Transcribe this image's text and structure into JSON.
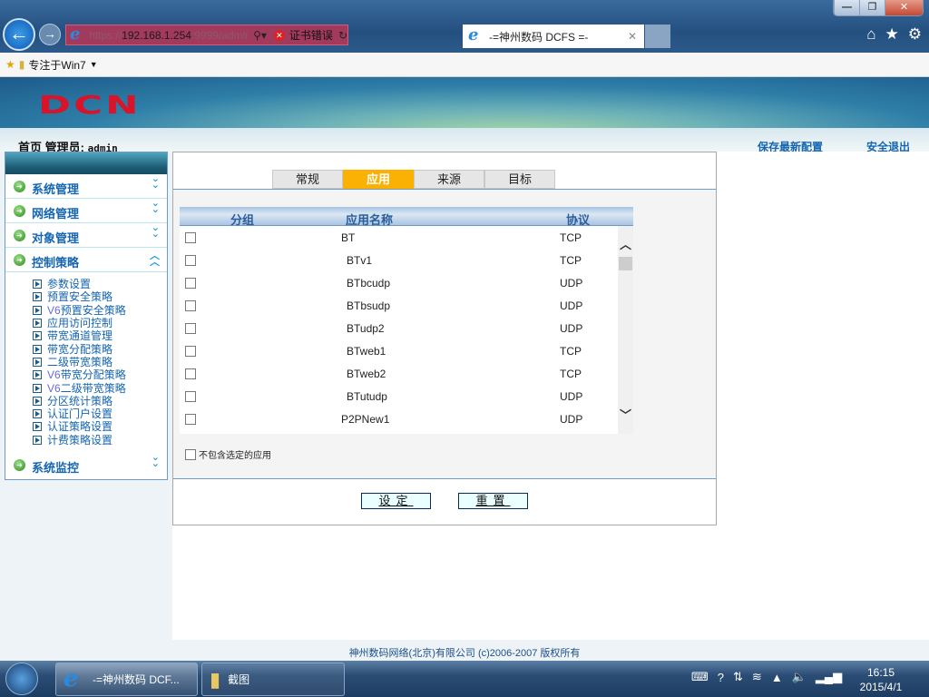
{
  "browser": {
    "url_host": "192.168.1.254",
    "url_prefix": "https://",
    "url_suffix": ":9999/admin/show/syster",
    "cert_error": "证书错误",
    "tab_title": "-=神州数码 DCFS =-",
    "favorites_folder": "专注于Win7"
  },
  "header": {
    "logo": "DCN",
    "home": "首页",
    "admin_label": "管理员:",
    "admin_name": "admin",
    "save_config": "保存最新配置",
    "logout": "安全退出"
  },
  "sidebar": {
    "menus": [
      {
        "label": "系统管理"
      },
      {
        "label": "网络管理"
      },
      {
        "label": "对象管理"
      },
      {
        "label": "控制策略"
      }
    ],
    "subitems": [
      {
        "prefix": "",
        "label": "参数设置"
      },
      {
        "prefix": "",
        "label": "预置安全策略"
      },
      {
        "prefix": "V6",
        "label": "预置安全策略"
      },
      {
        "prefix": "",
        "label": "应用访问控制"
      },
      {
        "prefix": "",
        "label": "带宽通道管理"
      },
      {
        "prefix": "",
        "label": "带宽分配策略"
      },
      {
        "prefix": "",
        "label": "二级带宽策略"
      },
      {
        "prefix": "V6",
        "label": "带宽分配策略"
      },
      {
        "prefix": "V6",
        "label": "二级带宽策略"
      },
      {
        "prefix": "",
        "label": "分区统计策略"
      },
      {
        "prefix": "",
        "label": "认证门户设置"
      },
      {
        "prefix": "",
        "label": "认证策略设置"
      },
      {
        "prefix": "",
        "label": "计费策略设置"
      }
    ],
    "last_menu": "系统监控"
  },
  "tabs": [
    "常规",
    "应用",
    "来源",
    "目标"
  ],
  "active_tab": "应用",
  "table": {
    "headers": {
      "group": "分组",
      "name": "应用名称",
      "protocol": "协议"
    },
    "rows": [
      {
        "name": "BT",
        "protocol": "TCP",
        "indent": false
      },
      {
        "name": "BTv1",
        "protocol": "TCP",
        "indent": true
      },
      {
        "name": "BTbcudp",
        "protocol": "UDP",
        "indent": true
      },
      {
        "name": "BTbsudp",
        "protocol": "UDP",
        "indent": true
      },
      {
        "name": "BTudp2",
        "protocol": "UDP",
        "indent": true
      },
      {
        "name": "BTweb1",
        "protocol": "TCP",
        "indent": true
      },
      {
        "name": "BTweb2",
        "protocol": "TCP",
        "indent": true
      },
      {
        "name": "BTutudp",
        "protocol": "UDP",
        "indent": true
      },
      {
        "name": "P2PNew1",
        "protocol": "UDP",
        "indent": false
      }
    ]
  },
  "exclude_label": "不包含选定的应用",
  "buttons": {
    "set": "设定",
    "reset": "重置"
  },
  "footer": "神州数码网络(北京)有限公司  (c)2006-2007  版权所有",
  "taskbar": {
    "ie_task": "-=神州数码 DCF...",
    "folder_task": "截图",
    "time": "16:15",
    "date": "2015/4/1"
  },
  "colors": {
    "active_tab": "#fbb103",
    "link": "#1565b0",
    "logo": "#d8142a"
  }
}
